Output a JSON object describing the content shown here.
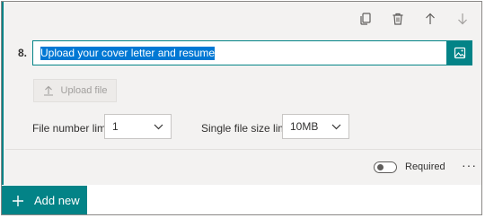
{
  "toolbar": {
    "icons": [
      "copy-icon",
      "delete-icon",
      "move-up-icon",
      "move-down-icon"
    ]
  },
  "question": {
    "number": "8.",
    "title": "Upload your cover letter and resume"
  },
  "upload": {
    "label": "Upload file"
  },
  "limits": {
    "file_number_label": "File number limit:",
    "file_number_value": "1",
    "file_size_label": "Single file size limit:",
    "file_size_value": "10MB"
  },
  "footer": {
    "required_label": "Required",
    "more_label": "···"
  },
  "add_new": {
    "label": "Add new",
    "plus": "+"
  },
  "colors": {
    "accent": "#038387",
    "selection": "#0078d4",
    "card_background": "#f3f2f1"
  }
}
